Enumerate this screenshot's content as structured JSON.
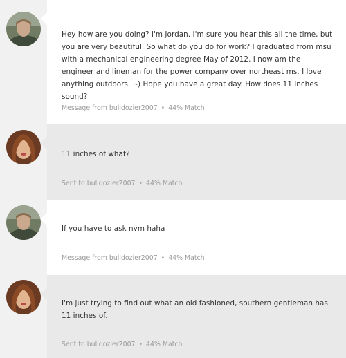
{
  "messages": [
    {
      "direction": "received",
      "avatar": "jordan-avatar",
      "text": "Hey how are you doing? I'm Jordan. I'm sure you hear this all the time, but you are very beautiful. So what do you do for work? I graduated from msu with a mechanical engineering degree May of 2012. I now am the engineer and lineman for the power company over northeast ms. I love anything outdoors. :-) Hope you have a great day. How does 11 inches sound?",
      "status": "Message from bulldozier2007",
      "match": "44% Match"
    },
    {
      "direction": "sent",
      "avatar": "user-avatar",
      "text": "11 inches of what?",
      "status": "Sent to bulldozier2007",
      "match": "44% Match"
    },
    {
      "direction": "received",
      "avatar": "jordan-avatar",
      "text": "If you have to ask nvm haha",
      "status": "Message from bulldozier2007",
      "match": "44% Match"
    },
    {
      "direction": "sent",
      "avatar": "user-avatar",
      "text": "I'm just trying to find out what an old fashioned, southern gentleman has 11 inches of.",
      "status": "Sent to bulldozier2007",
      "match": "44% Match"
    }
  ],
  "separator": "•",
  "colors": {
    "page_bg": "#f1f1f1",
    "received_bubble": "#ffffff",
    "sent_bubble": "#e9e9e9",
    "meta_text": "#9a9a9a"
  }
}
